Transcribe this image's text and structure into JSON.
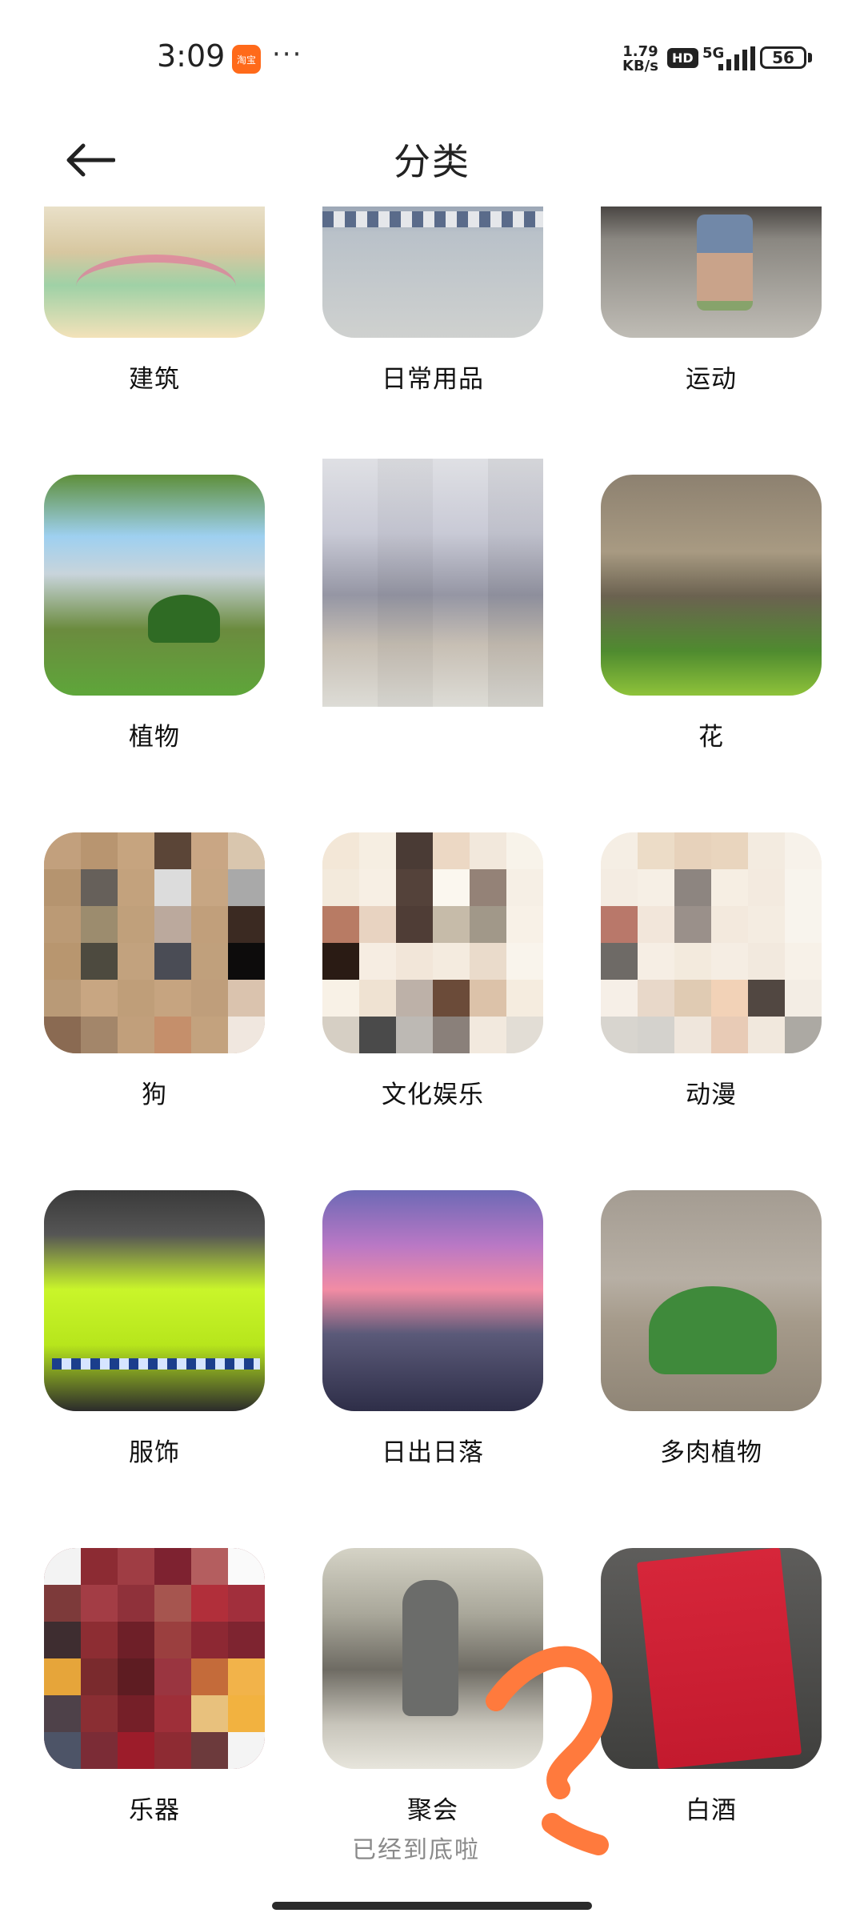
{
  "status_bar": {
    "time": "3:09",
    "app_badge": "淘宝",
    "more_dots": "···",
    "net_speed_value": "1.79",
    "net_speed_unit": "KB/s",
    "hd": "HD",
    "net_type": "5G",
    "battery": "56"
  },
  "header": {
    "back_icon": "arrow-left-icon",
    "title": "分类"
  },
  "categories": [
    {
      "label": "建筑",
      "thumb": "t-building"
    },
    {
      "label": "日常用品",
      "thumb": "t-daily"
    },
    {
      "label": "运动",
      "thumb": "t-sport"
    },
    {
      "label": "植物",
      "thumb": "t-plant"
    },
    {
      "label": "",
      "thumb": "t-pixel"
    },
    {
      "label": "花",
      "thumb": "t-flower"
    },
    {
      "label": "狗",
      "thumb": "t-dog"
    },
    {
      "label": "文化娱乐",
      "thumb": "t-culture"
    },
    {
      "label": "动漫",
      "thumb": "t-anime"
    },
    {
      "label": "服饰",
      "thumb": "t-clothes"
    },
    {
      "label": "日出日落",
      "thumb": "t-sunset"
    },
    {
      "label": "多肉植物",
      "thumb": "t-succulent"
    },
    {
      "label": "乐器",
      "thumb": "t-instrument"
    },
    {
      "label": "聚会",
      "thumb": "t-party"
    },
    {
      "label": "白酒",
      "thumb": "t-liquor"
    }
  ],
  "footer": {
    "end_text": "已经到底啦"
  },
  "colors": {
    "annotation": "#ff7a3d"
  }
}
